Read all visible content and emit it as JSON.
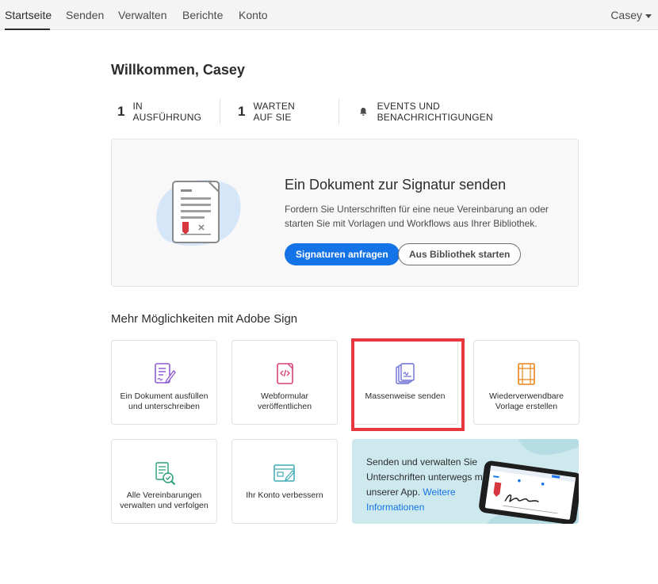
{
  "nav": {
    "items": [
      "Startseite",
      "Senden",
      "Verwalten",
      "Berichte",
      "Konto"
    ],
    "user": "Casey"
  },
  "welcome": "Willkommen, Casey",
  "stats": {
    "in_progress": {
      "count": "1",
      "label": "IN AUSFÜHRUNG"
    },
    "waiting": {
      "count": "1",
      "label": "WARTEN AUF SIE"
    },
    "events": {
      "label": "EVENTS UND BENACHRICHTIGUNGEN",
      "icon": "bell-icon"
    }
  },
  "hero": {
    "title": "Ein Dokument zur Signatur senden",
    "description": "Fordern Sie Unterschriften für eine neue Vereinbarung an oder starten Sie mit Vorlagen und Workflows aus Ihrer Bibliothek.",
    "primary_button": "Signaturen anfragen",
    "secondary_button": "Aus Bibliothek starten"
  },
  "more": {
    "title": "Mehr Möglichkeiten mit Adobe Sign",
    "cards": [
      {
        "label": "Ein Dokument ausfüllen und unterschreiben",
        "icon": "fill-sign-icon"
      },
      {
        "label": "Webformular veröffentlichen",
        "icon": "web-form-icon"
      },
      {
        "label": "Massenweise senden",
        "icon": "bulk-send-icon"
      },
      {
        "label": "Wiederverwendbare Vorlage erstellen",
        "icon": "template-icon"
      },
      {
        "label": "Alle Vereinbarungen verwalten und verfolgen",
        "icon": "manage-agreements-icon"
      },
      {
        "label": "Ihr Konto verbessern",
        "icon": "account-icon"
      }
    ],
    "promo": {
      "text": "Senden und verwalten Sie Unterschriften unterwegs mit unserer App.",
      "link": "Weitere Informationen"
    }
  },
  "colors": {
    "accent": "#1473e6",
    "highlight": "#e8383d",
    "promo_bg": "#cde9ee"
  }
}
